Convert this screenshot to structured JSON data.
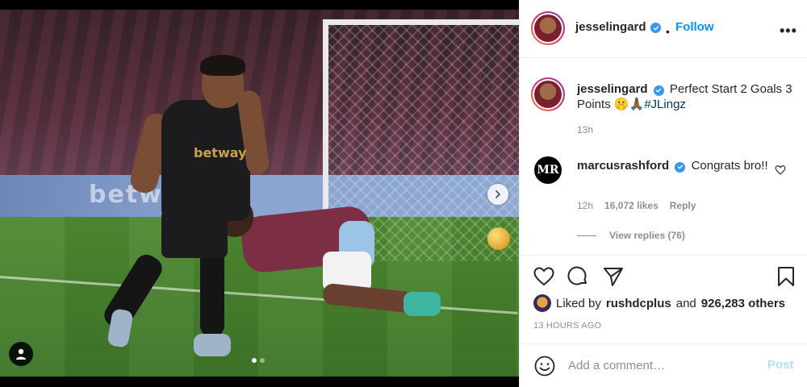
{
  "post": {
    "username": "jesselingard",
    "follow_dot": "•",
    "follow_label": "Follow",
    "more_label": "•••",
    "caption": {
      "username": "jesselingard",
      "text": "Perfect Start 2 Goals 3 Points 🤫🙏🏾",
      "hashtag": "#JLingz",
      "time": "13h"
    },
    "comment": {
      "username": "marcusrashford",
      "text": "Congrats bro!!",
      "avatar_text": "MR",
      "time": "12h",
      "likes": "16,072 likes",
      "reply_label": "Reply",
      "view_replies": "View replies (76)"
    },
    "liked_by": {
      "prefix": "Liked by",
      "user": "rushdcplus",
      "and": "and",
      "others": "926,283 others"
    },
    "posted_ago": "13 HOURS AGO",
    "add_comment_placeholder": "Add a comment…",
    "post_button": "Post"
  },
  "media": {
    "slide_index": 1,
    "slide_count": 2,
    "board_text": "betway"
  },
  "colors": {
    "accent": "#0095f6",
    "verified": "#3897f0",
    "post_disabled": "#b3dffc",
    "muted": "#8e8e8e",
    "hashtag": "#00376b"
  },
  "icons": [
    "verified-badge-icon",
    "more-options-icon",
    "heart-icon",
    "comment-icon",
    "share-icon",
    "bookmark-icon",
    "emoji-icon",
    "chevron-right-icon",
    "user-tag-icon"
  ]
}
